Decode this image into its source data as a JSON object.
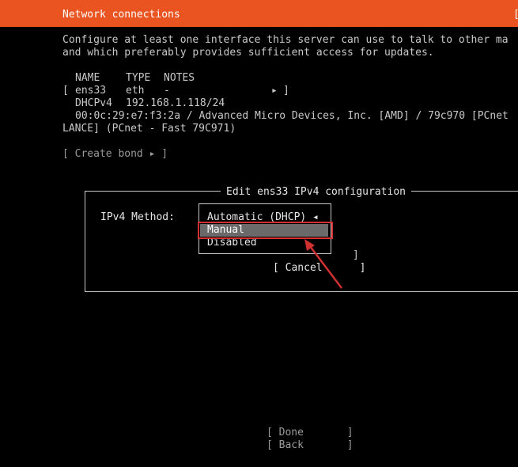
{
  "header": {
    "title": "Network connections",
    "help_bracket": "["
  },
  "description": [
    "Configure at least one interface this server can use to talk to other ma",
    "and which preferably provides sufficient access for updates."
  ],
  "interfaces": {
    "columns": [
      "NAME",
      "TYPE",
      "NOTES"
    ],
    "row": {
      "open_bracket": "[",
      "name": "ens33",
      "type": "eth",
      "notes": "-",
      "arrow": "▸",
      "close_bracket": "]"
    },
    "ipv4_label": "DHCPv4",
    "ipv4_address": "192.168.1.118/24",
    "device_line1": "00:0c:29:e7:f3:2a / Advanced Micro Devices, Inc. [AMD] / 79c970 [PCnet",
    "device_line2": "LANCE] (PCnet - Fast 79C971)"
  },
  "create_bond": "[ Create bond ▸ ]",
  "dialog": {
    "title": "Edit ens33 IPv4 configuration",
    "method_label": "IPv4 Method:",
    "dropdown": {
      "current": "Automatic (DHCP) ◂",
      "options": [
        "Manual",
        "Disabled"
      ],
      "highlighted": "Manual"
    },
    "save_close_bracket": "]",
    "cancel_button": "[ Cancel      ]"
  },
  "footer": {
    "done_button": "[ Done       ]",
    "back_button": "[ Back       ]"
  },
  "colors": {
    "header_bg": "#e95420",
    "highlight_bg": "#6a6a6a",
    "callout": "#d03030"
  }
}
